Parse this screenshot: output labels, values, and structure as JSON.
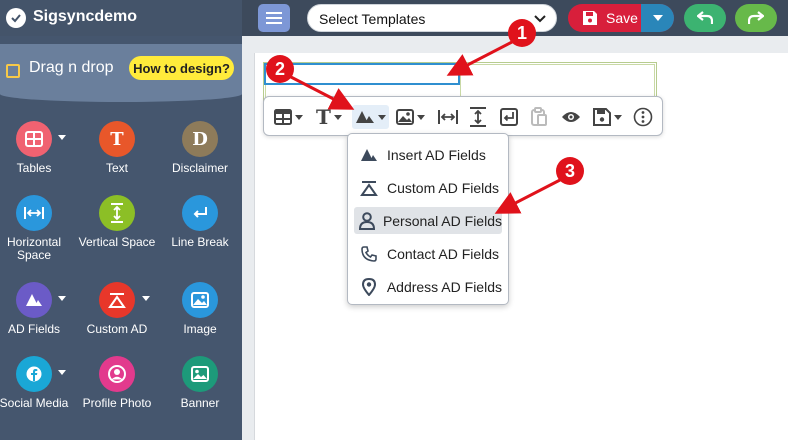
{
  "app": {
    "title": "Sigsyncdemo"
  },
  "header": {
    "template_select": "Select Templates",
    "save_label": "Save",
    "colors": {
      "bar": "#3d4a5c",
      "save": "#d81f3b",
      "save_dropdown": "#2a86b9",
      "undo": "#3cb371",
      "redo": "#67b94a",
      "menu": "#7d97d6"
    }
  },
  "sidebar": {
    "title": "Drag n drop",
    "how_button": "How to design?",
    "tools": [
      {
        "label": "Tables",
        "icon": "table-icon",
        "color": "#f06271"
      },
      {
        "label": "Text",
        "icon": "text-icon",
        "color": "#e8572a"
      },
      {
        "label": "Disclaimer",
        "icon": "disclaimer-icon",
        "color": "#8e7b5a"
      },
      {
        "label": "Horizontal Space",
        "icon": "horizontal-space-icon",
        "color": "#2a97dc"
      },
      {
        "label": "Vertical Space",
        "icon": "vertical-space-icon",
        "color": "#8cbf26"
      },
      {
        "label": "Line Break",
        "icon": "line-break-icon",
        "color": "#2a97dc"
      },
      {
        "label": "AD Fields",
        "icon": "ad-fields-icon",
        "color": "#6b5bc7"
      },
      {
        "label": "Custom AD",
        "icon": "custom-ad-icon",
        "color": "#e8372a"
      },
      {
        "label": "Image",
        "icon": "image-icon",
        "color": "#2a97dc"
      },
      {
        "label": "Social Media",
        "icon": "social-media-icon",
        "color": "#1aa7d6"
      },
      {
        "label": "Profile Photo",
        "icon": "profile-photo-icon",
        "color": "#e23a8d"
      },
      {
        "label": "Banner",
        "icon": "banner-icon",
        "color": "#1d9a7a"
      }
    ]
  },
  "dropdown": {
    "items": [
      {
        "label": "Insert AD Fields",
        "icon": "ad-fields-icon"
      },
      {
        "label": "Custom AD Fields",
        "icon": "custom-ad-icon"
      },
      {
        "label": "Personal AD Fields",
        "icon": "person-icon"
      },
      {
        "label": "Contact AD Fields",
        "icon": "phone-icon"
      },
      {
        "label": "Address AD Fields",
        "icon": "location-pin-icon"
      }
    ]
  },
  "callouts": [
    "1",
    "2",
    "3"
  ]
}
